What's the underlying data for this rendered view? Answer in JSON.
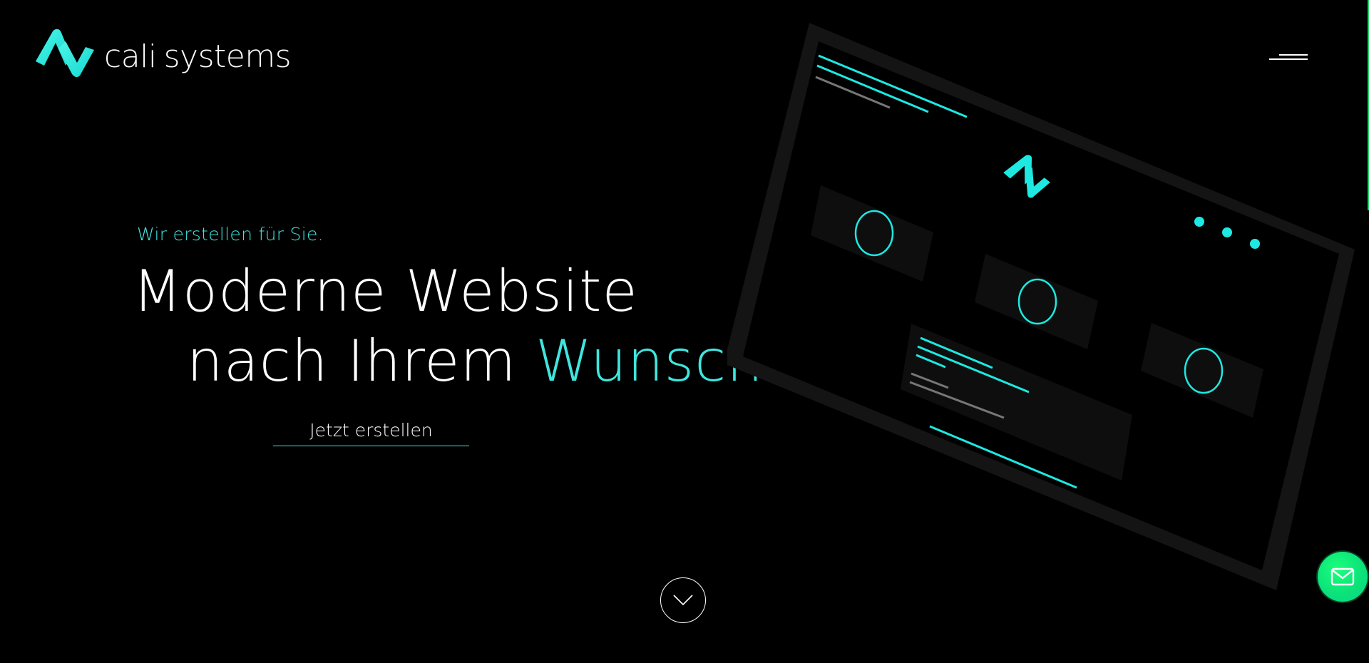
{
  "header": {
    "logo": {
      "icon": "cali-logo-mark",
      "word_a": "cali",
      "word_b": "systems"
    },
    "menu_icon": "hamburger-icon"
  },
  "hero": {
    "eyebrow": "Wir erstellen für Sie.",
    "title_line1": "Moderne Website",
    "title_line2_prefix": "nach Ihrem ",
    "title_line2_accent": "Wunsch",
    "cta_label": "Jetzt erstellen"
  },
  "scroll": {
    "icon": "chevron-down-icon"
  },
  "contact": {
    "icon": "mail-icon"
  },
  "colors": {
    "background": "#000000",
    "accent": "#3fe6de",
    "text": "#ffffff",
    "contact_button": "#0be07a"
  }
}
